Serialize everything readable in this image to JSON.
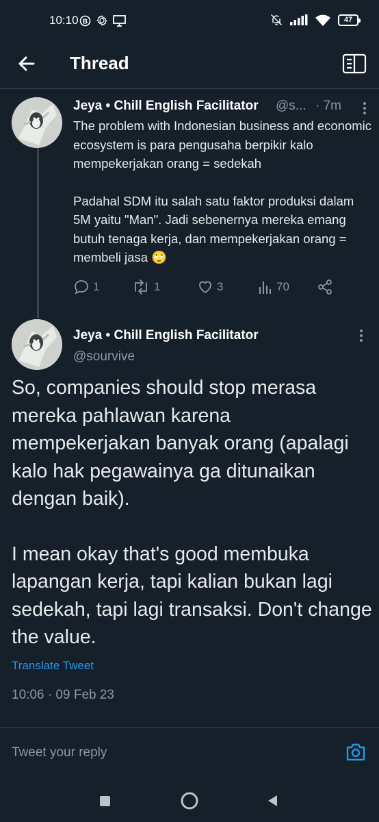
{
  "status_bar": {
    "time": "10:10",
    "battery": "47",
    "icons": [
      "b-badge-icon",
      "gear-icon",
      "monitor-icon",
      "bell-muted-icon",
      "signal-icon",
      "wifi-icon",
      "battery-icon"
    ]
  },
  "header": {
    "title": "Thread",
    "icons": [
      "back-arrow-icon",
      "reader-book-icon"
    ]
  },
  "parent_tweet": {
    "name": "Jeya • Chill English Facilitator",
    "handle": "@s...",
    "separator": "·",
    "time": "7m",
    "body_p1": "The problem with Indonesian business and economic ecosystem is para pengusaha berpikir kalo mempekerjakan orang = sedekah",
    "body_p2": "Padahal SDM itu salah satu faktor produksi dalam 5M yaitu \"Man\". Jadi sebenernya mereka emang butuh tenaga kerja, dan mempekerjakan orang = membeli jasa 🙄",
    "actions": {
      "replies": "1",
      "retweets": "1",
      "likes": "3",
      "views": "70"
    }
  },
  "main_tweet": {
    "name": "Jeya • Chill English Facilitator",
    "handle": "@sourvive",
    "body_p1": "So, companies should stop merasa mereka pahlawan karena mempekerjakan banyak orang (apalagi kalo hak pegawainya ga ditunaikan dengan baik).",
    "body_p2": "I mean okay that's good membuka lapangan kerja, tapi kalian bukan lagi sedekah, tapi lagi transaksi. Don't change the value.",
    "translate": "Translate Tweet",
    "timestamp": "10:06 · 09 Feb 23"
  },
  "reply": {
    "placeholder": "Tweet your reply"
  },
  "colors": {
    "background": "#15202b",
    "accent": "#1d9bf0",
    "secondary_text": "#8b98a5",
    "divider": "#38444d"
  }
}
